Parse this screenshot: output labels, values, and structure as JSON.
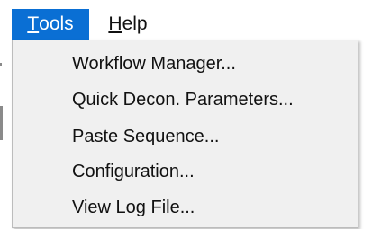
{
  "menubar": {
    "tools": {
      "accel": "T",
      "rest": "ools"
    },
    "help": {
      "accel": "H",
      "rest": "elp"
    }
  },
  "tools_menu": {
    "items": [
      {
        "label": "Workflow Manager..."
      },
      {
        "label": "Quick Decon. Parameters..."
      },
      {
        "label": "Paste Sequence..."
      },
      {
        "label": "Configuration..."
      },
      {
        "label": "View Log File..."
      }
    ]
  },
  "colors": {
    "menu_highlight": "#0a6fd4",
    "dropdown_bg": "#f0f0f0",
    "text": "#111111"
  }
}
